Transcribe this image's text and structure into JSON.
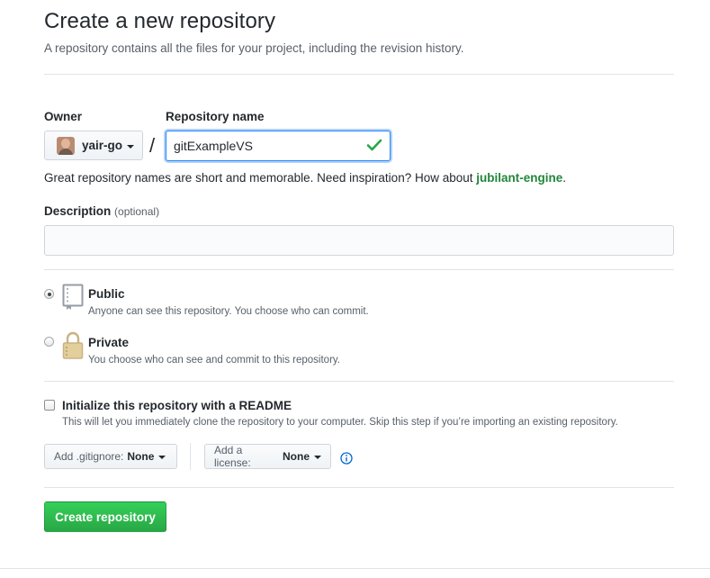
{
  "header": {
    "title": "Create a new repository",
    "subtitle": "A repository contains all the files for your project, including the revision history."
  },
  "owner": {
    "label": "Owner",
    "value": "yair-go"
  },
  "repo_name": {
    "label": "Repository name",
    "value": "gitExampleVS",
    "valid": true
  },
  "name_hint": {
    "text": "Great repository names are short and memorable. Need inspiration? How about ",
    "suggestion": "jubilant-engine",
    "suffix": "."
  },
  "description": {
    "label": "Description",
    "optional": "(optional)",
    "value": ""
  },
  "visibility": {
    "selected": "public",
    "public": {
      "title": "Public",
      "desc": "Anyone can see this repository. You choose who can commit."
    },
    "private": {
      "title": "Private",
      "desc": "You choose who can see and commit to this repository."
    }
  },
  "readme": {
    "title": "Initialize this repository with a README",
    "desc": "This will let you immediately clone the repository to your computer. Skip this step if you’re importing an existing repository.",
    "checked": false
  },
  "gitignore": {
    "label": "Add .gitignore:",
    "value": "None"
  },
  "license": {
    "label": "Add a license:",
    "value": "None"
  },
  "submit": {
    "label": "Create repository"
  },
  "colors": {
    "accent_green": "#28a745",
    "focus_blue": "#2188ff",
    "text": "#24292e",
    "muted": "#586069"
  },
  "icons": [
    "check-icon",
    "book-icon",
    "lock-icon",
    "info-icon",
    "caret-down-icon"
  ]
}
